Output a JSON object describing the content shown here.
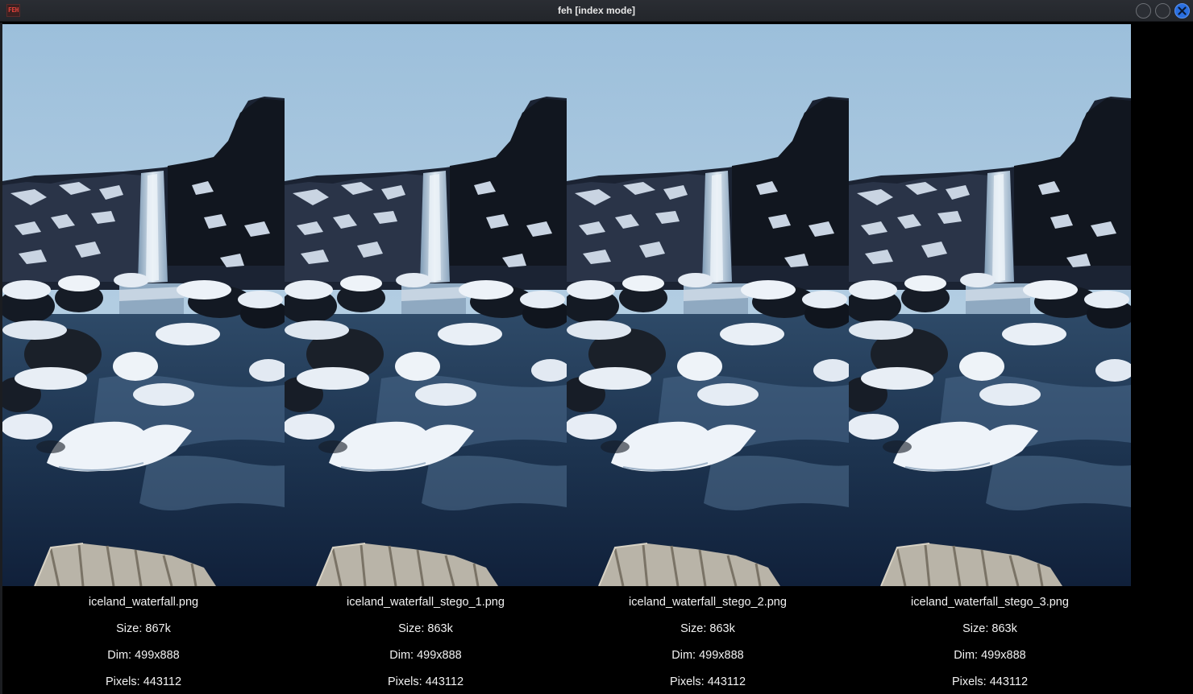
{
  "window": {
    "title": "feh [index mode]",
    "app_icon_text": "FEH"
  },
  "titlebar_buttons": {
    "minimize_icon": "circle-icon",
    "maximize_icon": "circle-icon",
    "close_icon": "close-icon",
    "close_color": "#2a6fe0"
  },
  "thumbnails": [
    {
      "filename": "iceland_waterfall.png",
      "size": "Size: 867k",
      "dim": "Dim: 499x888",
      "pixels": "Pixels: 443112"
    },
    {
      "filename": "iceland_waterfall_stego_1.png",
      "size": "Size: 863k",
      "dim": "Dim: 499x888",
      "pixels": "Pixels: 443112"
    },
    {
      "filename": "iceland_waterfall_stego_2.png",
      "size": "Size: 863k",
      "dim": "Dim: 499x888",
      "pixels": "Pixels: 443112"
    },
    {
      "filename": "iceland_waterfall_stego_3.png",
      "size": "Size: 863k",
      "dim": "Dim: 499x888",
      "pixels": "Pixels: 443112"
    }
  ]
}
